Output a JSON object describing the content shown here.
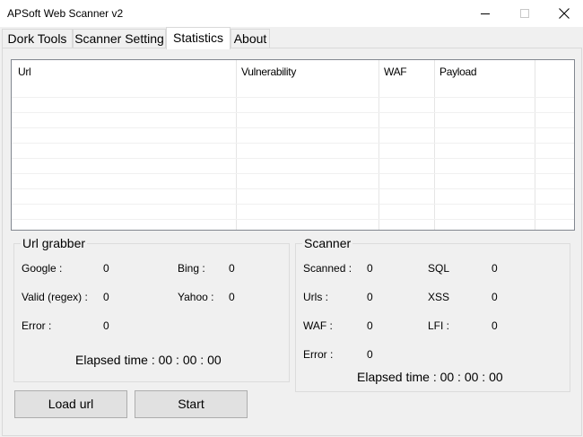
{
  "window": {
    "title": "APSoft Web Scanner v2",
    "controls": {
      "minimize": "minimize-icon",
      "maximize": "maximize-icon",
      "close": "close-icon"
    }
  },
  "tabs": [
    {
      "label": "Dork Tools",
      "active": false
    },
    {
      "label": "Scanner Setting",
      "active": false
    },
    {
      "label": "Statistics",
      "active": true
    },
    {
      "label": "About",
      "active": false
    }
  ],
  "results_table": {
    "columns": [
      "Url",
      "Vulnerability",
      "WAF",
      "Payload"
    ],
    "rows": []
  },
  "url_grabber": {
    "title": "Url grabber",
    "stats": [
      {
        "label": "Google :",
        "value": "0"
      },
      {
        "label": "Bing :",
        "value": "0"
      },
      {
        "label": "Valid (regex) :",
        "value": "0"
      },
      {
        "label": "Yahoo :",
        "value": "0"
      },
      {
        "label": "Error :",
        "value": "0"
      }
    ],
    "elapsed": "Elapsed time : 00 : 00 : 00"
  },
  "scanner": {
    "title": "Scanner",
    "stats": [
      {
        "label": "Scanned :",
        "value": "0"
      },
      {
        "label": "SQL",
        "value": "0"
      },
      {
        "label": "Urls :",
        "value": "0"
      },
      {
        "label": "XSS",
        "value": "0"
      },
      {
        "label": "WAF :",
        "value": "0"
      },
      {
        "label": "LFI :",
        "value": "0"
      },
      {
        "label": "Error :",
        "value": "0"
      }
    ],
    "elapsed": "Elapsed time : 00 : 00 : 00"
  },
  "buttons": {
    "load_url": "Load url",
    "start": "Start"
  }
}
